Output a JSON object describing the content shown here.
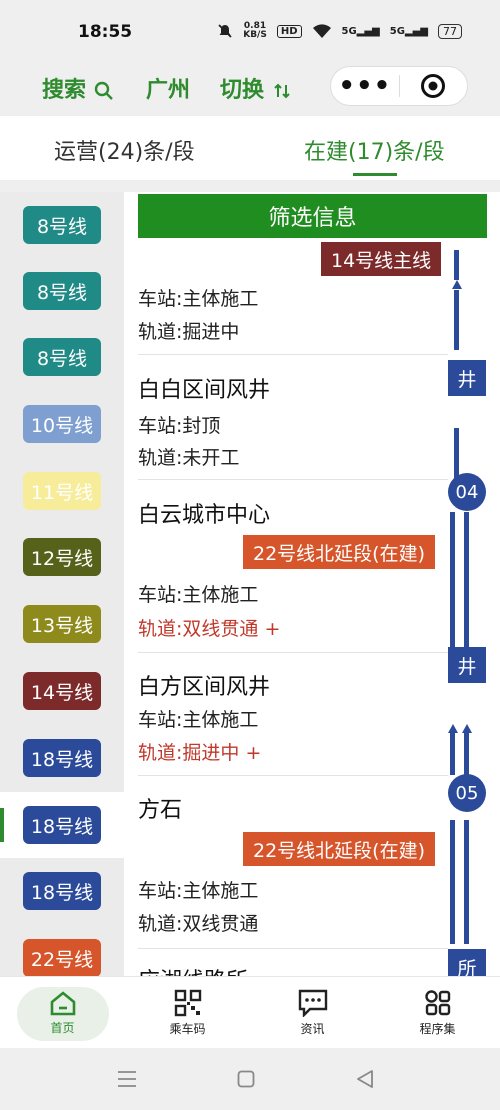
{
  "status_bar": {
    "time": "18:55",
    "net_speed_value": "0.81",
    "net_speed_unit": "KB/S",
    "hd": "HD",
    "sig1": "5G",
    "sig2": "5G",
    "battery": "77"
  },
  "header": {
    "search_label": "搜索",
    "city": "广州",
    "switch_label": "切换"
  },
  "tabs": [
    {
      "label": "运营(24)条/段"
    },
    {
      "label": "在建(17)条/段"
    }
  ],
  "sidebar": {
    "items": [
      {
        "label": "8号线",
        "color": "#1f8a86"
      },
      {
        "label": "8号线",
        "color": "#1f8a86"
      },
      {
        "label": "8号线",
        "color": "#1f8a86"
      },
      {
        "label": "10号线",
        "color": "#7e9fd0"
      },
      {
        "label": "11号线",
        "color": "#f6ec9a"
      },
      {
        "label": "12号线",
        "color": "#56621a"
      },
      {
        "label": "13号线",
        "color": "#8f8a1c"
      },
      {
        "label": "14号线",
        "color": "#7d2a2a"
      },
      {
        "label": "18号线",
        "color": "#2b4a9a"
      },
      {
        "label": "18号线",
        "color": "#2b4a9a"
      },
      {
        "label": "18号线",
        "color": "#2b4a9a"
      },
      {
        "label": "22号线",
        "color": "#d6552b"
      }
    ]
  },
  "main": {
    "filter_label": "筛选信息",
    "stations": [
      {
        "name": "",
        "tag": "14号线主线",
        "station_status": "车站:主体施工",
        "track_status": "轨道:掘进中"
      },
      {
        "name": "白白区间风井",
        "badge": "井",
        "station_status": "车站:封顶",
        "track_status": "轨道:未开工"
      },
      {
        "name": "白云城市中心",
        "badge": "04",
        "tag": "22号线北延段(在建)",
        "station_status": "车站:主体施工",
        "track_status": "轨道:双线贯通 +"
      },
      {
        "name": "白方区间风井",
        "badge": "井",
        "station_status": "车站:主体施工",
        "track_status": "轨道:掘进中 +"
      },
      {
        "name": "方石",
        "badge": "05",
        "tag": "22号线北延段(在建)",
        "station_status": "车站:主体施工",
        "track_status": "轨道:双线贯通"
      },
      {
        "name": "应湖线路所",
        "badge": "所"
      }
    ]
  },
  "bottom_nav": [
    {
      "label": "首页"
    },
    {
      "label": "乘车码"
    },
    {
      "label": "资讯"
    },
    {
      "label": "程序集"
    }
  ],
  "colors": {
    "accent": "#2e8b2e",
    "filter_bg": "#1f8d1f",
    "line22": "#d6552b",
    "line14": "#7d2a2a",
    "line18": "#2b4a9a"
  }
}
